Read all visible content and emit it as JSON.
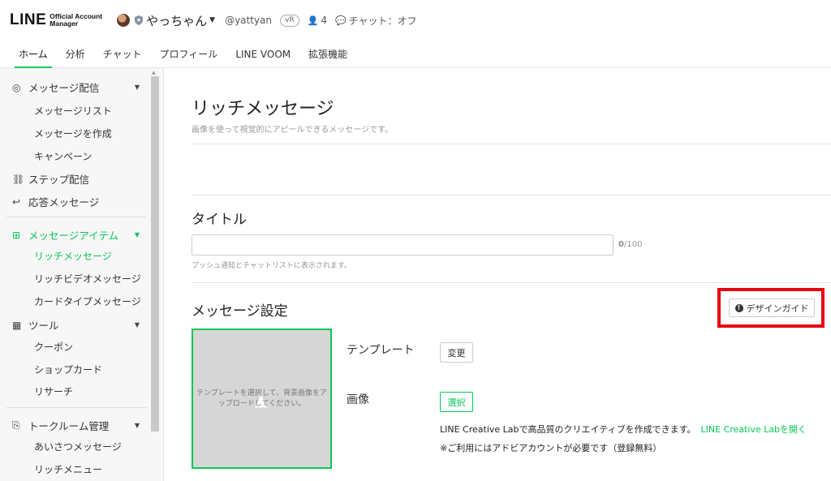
{
  "header": {
    "logo_main": "LINE",
    "logo_sub_1": "Official Account",
    "logo_sub_2": "Manager",
    "account_name": "やっちゃん",
    "account_handle": "@yattyan",
    "badge": "vR",
    "follower_count": "4",
    "chat_status": "チャット：オフ"
  },
  "tabs": [
    {
      "label": "ホーム"
    },
    {
      "label": "分析"
    },
    {
      "label": "チャット"
    },
    {
      "label": "プロフィール"
    },
    {
      "label": "LINE VOOM"
    },
    {
      "label": "拡張機能"
    }
  ],
  "sidebar": {
    "groups": {
      "message_delivery": "メッセージ配信",
      "step_delivery": "ステップ配信",
      "auto_reply": "応答メッセージ",
      "message_items": "メッセージアイテム",
      "tools": "ツール",
      "talk_room": "トークルーム管理"
    },
    "items": {
      "message_list": "メッセージリスト",
      "create_message": "メッセージを作成",
      "campaign": "キャンペーン",
      "rich_message": "リッチメッセージ",
      "rich_video": "リッチビデオメッセージ",
      "card_type": "カードタイプメッセージ",
      "coupon": "クーポン",
      "shop_card": "ショップカード",
      "research": "リサーチ",
      "greeting": "あいさつメッセージ",
      "rich_menu": "リッチメニュー"
    }
  },
  "main": {
    "title": "リッチメッセージ",
    "subtitle": "画像を使って視覚的にアピールできるメッセージです。",
    "title_section": "タイトル",
    "title_value": "",
    "title_counter_current": "0",
    "title_counter_max": "/100",
    "title_hint": "プッシュ通知とチャットリストに表示されます。",
    "settings_section": "メッセージ設定",
    "design_guide_label": "デザインガイド",
    "preview_text": "テンプレートを選択して、背景画像をアップロードしてください。",
    "template_label": "テンプレート",
    "change_button": "変更",
    "image_label": "画像",
    "select_button": "選択",
    "lab_text": "LINE Creative Labで高品質のクリエイティブを作成できます。",
    "lab_link": "LINE Creative Labを開く",
    "note": "※ご利用にはアドビアカウントが必要です（登録無料）"
  },
  "colors": {
    "accent": "#06c755",
    "highlight": "#e60012"
  }
}
